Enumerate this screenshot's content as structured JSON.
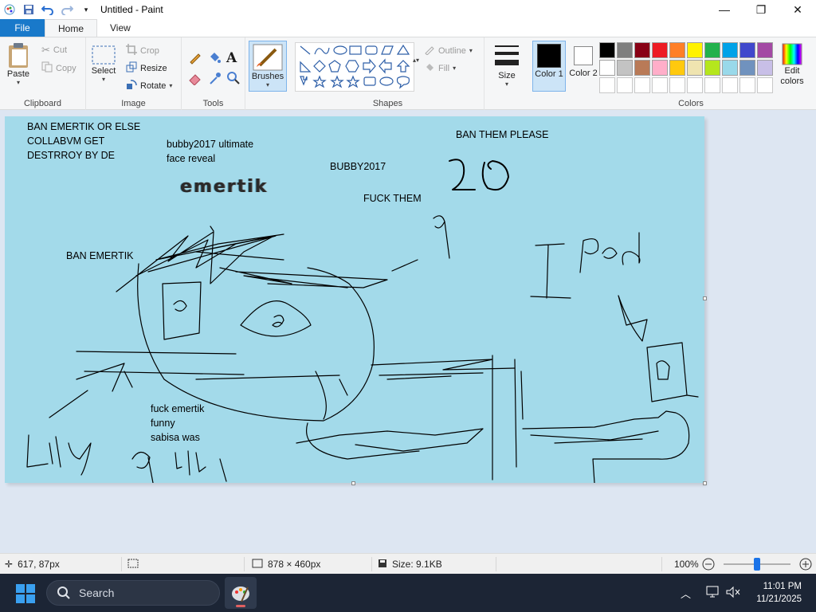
{
  "window": {
    "title": "Untitled - Paint"
  },
  "tabs": [
    {
      "label": "File"
    },
    {
      "label": "Home"
    },
    {
      "label": "View"
    }
  ],
  "ribbon": {
    "clipboard": {
      "paste": "Paste",
      "cut": "Cut",
      "copy": "Copy",
      "group": "Clipboard"
    },
    "image": {
      "select": "Select",
      "crop": "Crop",
      "resize": "Resize",
      "rotate": "Rotate",
      "group": "Image"
    },
    "tools": {
      "group": "Tools"
    },
    "brushes": {
      "label": "Brushes"
    },
    "shapes": {
      "outline": "Outline",
      "fill": "Fill",
      "group": "Shapes"
    },
    "size": {
      "label": "Size"
    },
    "color1": {
      "label": "Color 1",
      "value": "#000000"
    },
    "color2": {
      "label": "Color 2",
      "value": "#ffffff"
    },
    "colors": {
      "group": "Colors",
      "edit_label": "Edit colors",
      "row1": [
        "#000000",
        "#7f7f7f",
        "#880015",
        "#ed1c24",
        "#ff7f27",
        "#fff200",
        "#22b14c",
        "#00a2e8",
        "#3f48cc",
        "#a349a4"
      ],
      "row2": [
        "#ffffff",
        "#c3c3c3",
        "#b97a57",
        "#ffaec9",
        "#ffc90e",
        "#efe4b0",
        "#b5e61d",
        "#99d9ea",
        "#7092be",
        "#c8bfe7"
      ]
    }
  },
  "canvas": {
    "background": "#a3daea",
    "texts": {
      "t1": "BAN EMERTIK OR ELSE\nCOLLABVM GET\nDESTRROY BY DE",
      "t2": "bubby2017 ultimate\nface reveal",
      "t3": "BUBBY2017",
      "t4": "BAN THEM PLEASE",
      "t5": "FUCK THEM",
      "t6": "BAN EMERTIK",
      "t7": "fuck emertik\nfunny\nsabisa was",
      "logo": "emertik"
    }
  },
  "status": {
    "cursor": "617, 87px",
    "dimensions": "878 × 460px",
    "size": "Size: 9.1KB",
    "zoom": "100%",
    "zoom_level": 0.5
  },
  "taskbar": {
    "search_placeholder": "Search",
    "time": "11:01 PM",
    "date": "11/21/2025"
  }
}
